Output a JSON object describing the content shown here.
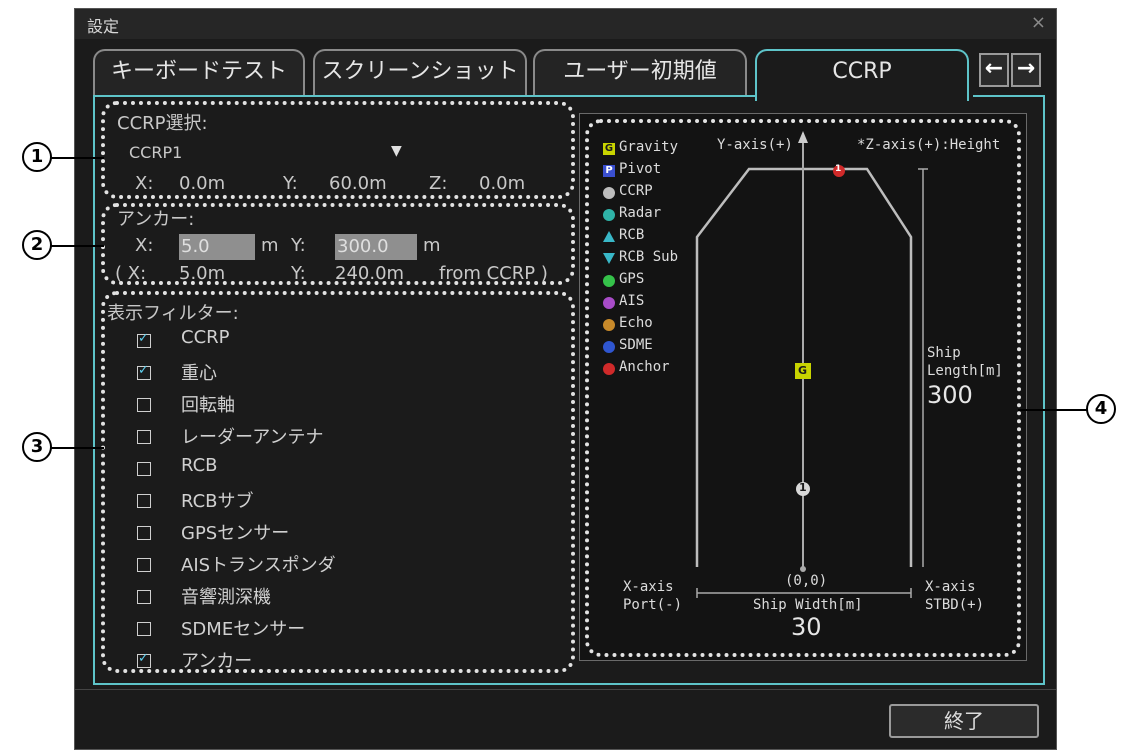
{
  "window": {
    "title": "設定",
    "close": "×"
  },
  "tabs": [
    {
      "label": "キーボードテスト"
    },
    {
      "label": "スクリーンショット"
    },
    {
      "label": "ユーザー初期値"
    },
    {
      "label": "CCRP"
    }
  ],
  "nav": {
    "prev": "←",
    "next": "→"
  },
  "ccrp": {
    "heading": "CCRP選択:",
    "selected": "CCRP1",
    "x_label": "X:",
    "x_value": "0.0m",
    "y_label": "Y:",
    "y_value": "60.0m",
    "z_label": "Z:",
    "z_value": "0.0m"
  },
  "anchor": {
    "heading": "アンカー:",
    "x_label": "X:",
    "x_value": "5.0",
    "x_unit": "m",
    "y_label": "Y:",
    "y_value": "300.0",
    "y_unit": "m",
    "rel_open": "( X:",
    "rel_x": "5.0m",
    "rel_y_label": "Y:",
    "rel_y": "240.0m",
    "rel_from": "from CCRP )"
  },
  "filters": {
    "heading": "表示フィルター:",
    "items": [
      {
        "label": "CCRP",
        "checked": true
      },
      {
        "label": "重心",
        "checked": true
      },
      {
        "label": "回転軸",
        "checked": false
      },
      {
        "label": "レーダーアンテナ",
        "checked": false
      },
      {
        "label": "RCB",
        "checked": false
      },
      {
        "label": "RCBサブ",
        "checked": false
      },
      {
        "label": "GPSセンサー",
        "checked": false
      },
      {
        "label": "AISトランスポンダ",
        "checked": false
      },
      {
        "label": "音響測深機",
        "checked": false
      },
      {
        "label": "SDMEセンサー",
        "checked": false
      },
      {
        "label": "アンカー",
        "checked": true
      }
    ]
  },
  "legend": [
    {
      "label": "Gravity",
      "symbol": "square-G",
      "color": "#c8d400"
    },
    {
      "label": "Pivot",
      "symbol": "square-P",
      "color": "#3a4fd0"
    },
    {
      "label": "CCRP",
      "symbol": "circle",
      "color": "#bdbdbd"
    },
    {
      "label": "Radar",
      "symbol": "circle",
      "color": "#2fb3a8"
    },
    {
      "label": "RCB",
      "symbol": "triangle-up",
      "color": "#39b8c8"
    },
    {
      "label": "RCB Sub",
      "symbol": "triangle-down",
      "color": "#39b8c8"
    },
    {
      "label": "GPS",
      "symbol": "circle",
      "color": "#35c24a"
    },
    {
      "label": "AIS",
      "symbol": "circle",
      "color": "#a84cc8"
    },
    {
      "label": "Echo",
      "symbol": "circle",
      "color": "#c88a2a"
    },
    {
      "label": "SDME",
      "symbol": "circle",
      "color": "#2f56d0"
    },
    {
      "label": "Anchor",
      "symbol": "circle",
      "color": "#d02a2a"
    }
  ],
  "ship": {
    "y_axis_label": "Y-axis(+)",
    "z_axis_label": "*Z-axis(+):Height",
    "length_label_1": "Ship",
    "length_label_2": "Length[m]",
    "length_value": "300",
    "origin_label": "(0,0)",
    "width_label": "Ship Width[m]",
    "width_value": "30",
    "port_label_1": "X-axis",
    "port_label_2": "Port(-)",
    "stbd_label_1": "X-axis",
    "stbd_label_2": "STBD(+)",
    "gravity_marker": "G",
    "ccrp_marker": "1",
    "anchor_marker": "1"
  },
  "callouts": [
    "1",
    "2",
    "3",
    "4"
  ],
  "ok_button": "終了"
}
